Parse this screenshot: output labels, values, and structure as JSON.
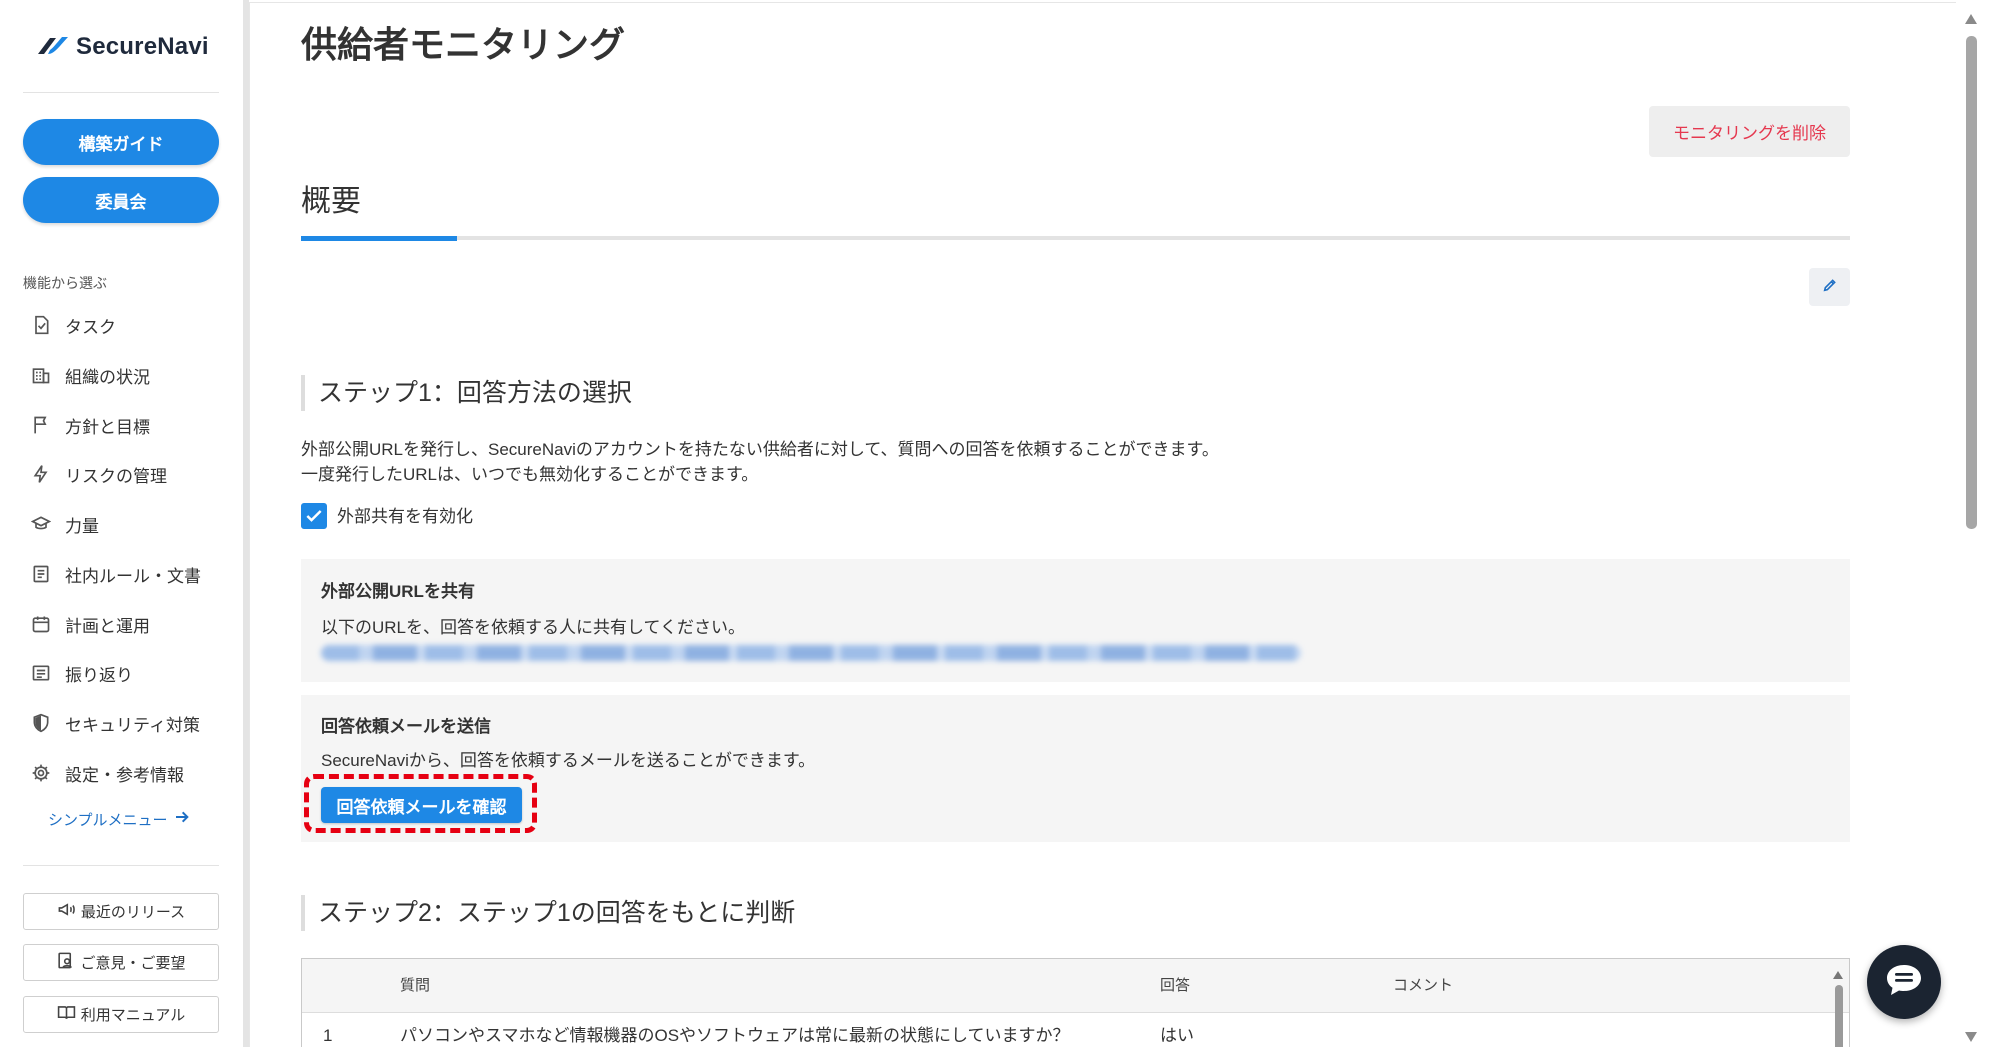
{
  "app": {
    "logo_text": "SecureNavi",
    "logo_icon": "securenavi-logo-icon"
  },
  "sidebar": {
    "primary_buttons": [
      {
        "label": "構築ガイド"
      },
      {
        "label": "委員会"
      }
    ],
    "section_label": "機能から選ぶ",
    "items": [
      {
        "label": "タスク",
        "icon": "task-icon"
      },
      {
        "label": "組織の状況",
        "icon": "building-icon"
      },
      {
        "label": "方針と目標",
        "icon": "flag-icon"
      },
      {
        "label": "リスクの管理",
        "icon": "bolt-icon"
      },
      {
        "label": "力量",
        "icon": "graduation-cap-icon"
      },
      {
        "label": "社内ルール・文書",
        "icon": "document-icon"
      },
      {
        "label": "計画と運用",
        "icon": "calendar-icon"
      },
      {
        "label": "振り返り",
        "icon": "list-icon"
      },
      {
        "label": "セキュリティ対策",
        "icon": "shield-icon"
      },
      {
        "label": "設定・参考情報",
        "icon": "gear-icon"
      }
    ],
    "simple_menu_link": "シンプルメニュー",
    "footer_buttons": [
      {
        "label": "最近のリリース",
        "icon": "megaphone-icon"
      },
      {
        "label": "ご意見・ご要望",
        "icon": "feedback-icon"
      },
      {
        "label": "利用マニュアル",
        "icon": "book-icon"
      }
    ]
  },
  "page": {
    "title": "供給者モニタリング",
    "delete_button": "モニタリングを削除",
    "tab_label": "概要"
  },
  "step1": {
    "heading": "ステップ1：回答方法の選択",
    "description": [
      "外部公開URLを発行し、SecureNaviのアカウントを持たない供給者に対して、質問への回答を依頼することができます。",
      "一度発行したURLは、いつでも無効化することができます。"
    ],
    "enable_sharing": {
      "label": "外部共有を有効化",
      "checked": true
    },
    "share_url_box": {
      "title": "外部公開URLを共有",
      "text": "以下のURLを、回答を依頼する人に共有してください。"
    },
    "email_box": {
      "title": "回答依頼メールを送信",
      "text": "SecureNaviから、回答を依頼するメールを送ることができます。",
      "button": "回答依頼メールを確認"
    }
  },
  "step2": {
    "heading": "ステップ2：ステップ1の回答をもとに判断",
    "table": {
      "headers": {
        "question": "質問",
        "answer": "回答",
        "comment": "コメント"
      },
      "rows": [
        {
          "no": "1",
          "question": "パソコンやスマホなど情報機器のOSやソフトウェアは常に最新の状態にしていますか？",
          "answer": "はい"
        }
      ]
    }
  },
  "colors": {
    "accent": "#1e88e5",
    "danger_text": "#e5384f",
    "highlight_outline": "#e60012",
    "chat_button": "#1b2431"
  }
}
